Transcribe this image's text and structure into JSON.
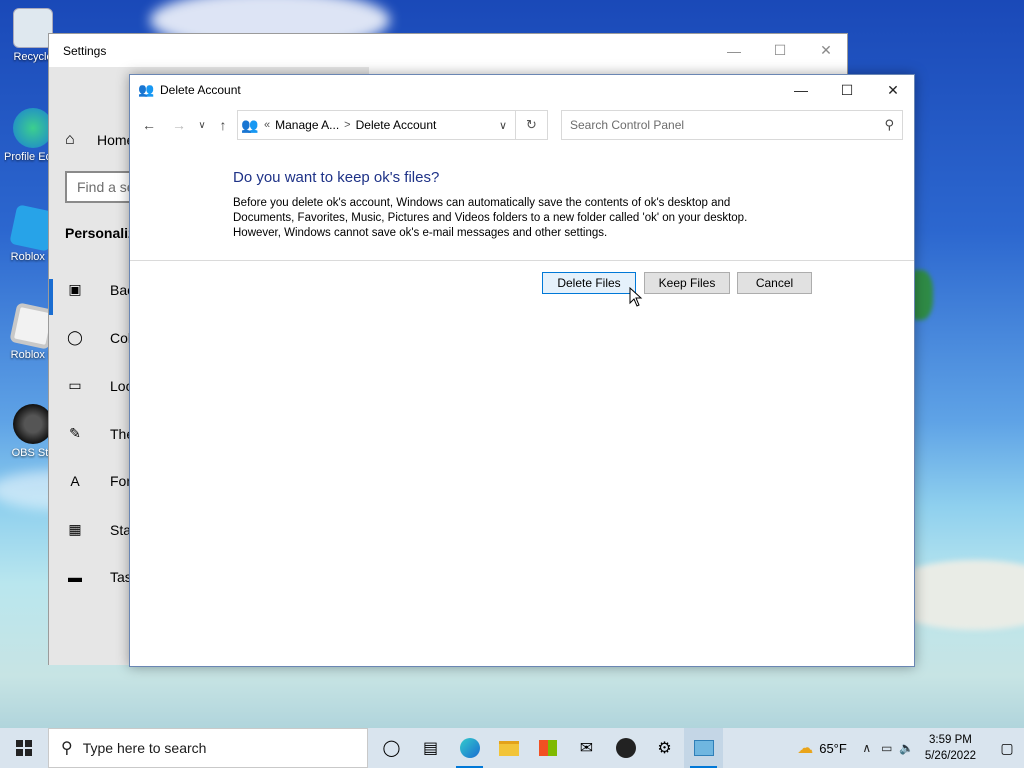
{
  "desktop": {
    "icons": [
      {
        "label": "Recycle",
        "icon": "recycle-bin-icon"
      },
      {
        "label": "Profile Edge",
        "icon": "edge-profile-icon"
      },
      {
        "label": "Roblox S",
        "icon": "roblox-studio-icon"
      },
      {
        "label": "Roblox P",
        "icon": "roblox-player-icon"
      },
      {
        "label": "OBS Stu",
        "icon": "obs-studio-icon"
      }
    ]
  },
  "settings": {
    "title": "Settings",
    "home_label": "Home",
    "find_placeholder": "Find a se",
    "section_heading": "Personaliz",
    "items": [
      {
        "label": "Backg",
        "icon": "image-icon"
      },
      {
        "label": "Colo",
        "icon": "palette-icon"
      },
      {
        "label": "Lock s",
        "icon": "lock-screen-icon"
      },
      {
        "label": "Them",
        "icon": "brush-icon"
      },
      {
        "label": "Fonts",
        "icon": "font-icon"
      },
      {
        "label": "Start",
        "icon": "start-grid-icon"
      },
      {
        "label": "Taskb",
        "icon": "taskbar-icon"
      }
    ]
  },
  "dialog": {
    "title": "Delete Account",
    "breadcrumb": {
      "prefix": "«",
      "parent": "Manage A...",
      "separator": ">",
      "current": "Delete Account"
    },
    "search_placeholder": "Search Control Panel",
    "heading": "Do you want to keep ok's files?",
    "body": "Before you delete ok's account, Windows can automatically save the contents of ok's desktop and Documents, Favorites, Music, Pictures and Videos folders to a new folder called 'ok' on your desktop. However, Windows cannot save ok's e-mail messages and other settings.",
    "buttons": {
      "delete_files": "Delete Files",
      "keep_files": "Keep Files",
      "cancel": "Cancel"
    }
  },
  "taskbar": {
    "search_placeholder": "Type here to search",
    "apps": [
      "task-view-icon",
      "cortana-icon",
      "edge-icon",
      "file-explorer-icon",
      "store-icon",
      "mail-icon",
      "obs-icon",
      "settings-icon",
      "control-panel-icon"
    ],
    "weather": "65°F",
    "time": "3:59 PM",
    "date": "5/26/2022"
  },
  "colors": {
    "accent": "#0078d7",
    "heading_blue": "#1e3287"
  }
}
